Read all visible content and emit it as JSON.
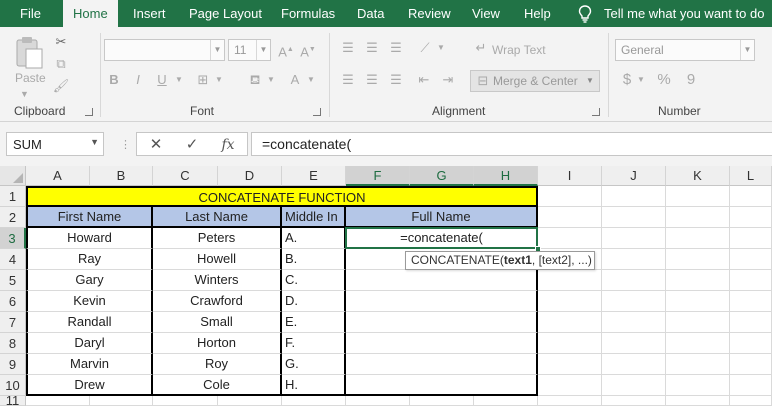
{
  "tabs": [
    "File",
    "Home",
    "Insert",
    "Page Layout",
    "Formulas",
    "Data",
    "Review",
    "View",
    "Help"
  ],
  "active_tab": "Home",
  "tell_me": "Tell me what you want to do",
  "ribbon": {
    "clipboard": {
      "label": "Clipboard",
      "paste_label": "Paste"
    },
    "font": {
      "label": "Font",
      "font_name": "",
      "font_size": "11",
      "bold": "B",
      "italic": "I",
      "underline": "U"
    },
    "alignment": {
      "label": "Alignment",
      "wrap_text": "Wrap Text",
      "merge_center": "Merge & Center"
    },
    "number": {
      "label": "Number",
      "format": "General",
      "currency": "$",
      "percent": "%",
      "comma": "9"
    }
  },
  "formula_bar": {
    "name_box": "SUM",
    "cancel": "✕",
    "enter": "✓",
    "fx": "fx",
    "formula": "=concatenate("
  },
  "columns": [
    "A",
    "B",
    "C",
    "D",
    "E",
    "F",
    "G",
    "H",
    "I",
    "J",
    "K",
    "L"
  ],
  "rows": [
    "1",
    "2",
    "3",
    "4",
    "5",
    "6",
    "7",
    "8",
    "9",
    "10",
    "11"
  ],
  "sheet": {
    "title": "CONCATENATE FUNCTION",
    "headers": {
      "first": "First Name",
      "last": "Last Name",
      "middle": "Middle In",
      "full": "Full Name"
    },
    "data": [
      {
        "first": "Howard",
        "last": "Peters",
        "middle": "A."
      },
      {
        "first": "Ray",
        "last": "Howell",
        "middle": "B."
      },
      {
        "first": "Gary",
        "last": "Winters",
        "middle": "C."
      },
      {
        "first": "Kevin",
        "last": "Crawford",
        "middle": "D."
      },
      {
        "first": "Randall",
        "last": "Small",
        "middle": "E."
      },
      {
        "first": "Daryl",
        "last": "Horton",
        "middle": "F."
      },
      {
        "first": "Marvin",
        "last": "Roy",
        "middle": "G."
      },
      {
        "first": "Drew",
        "last": "Cole",
        "middle": "H."
      }
    ],
    "editing_value": "=concatenate("
  },
  "tooltip": {
    "fn": "CONCATENATE(",
    "arg1": "text1",
    "rest": ", [text2], ...)"
  },
  "colors": {
    "brand": "#217346",
    "title_fill": "#ffff00",
    "header_fill": "#b4c6e7"
  }
}
